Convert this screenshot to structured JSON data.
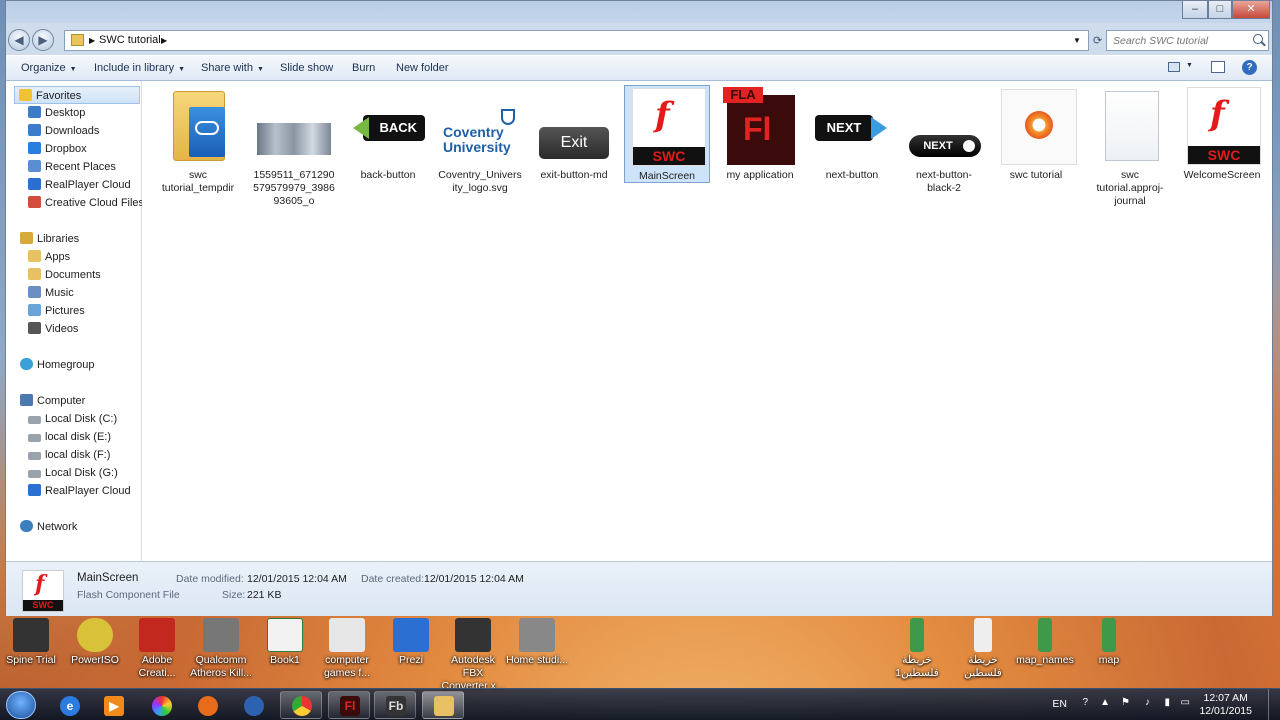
{
  "window": {
    "breadcrumb": [
      "SWC tutorial"
    ],
    "search_placeholder": "Search SWC tutorial",
    "controls": {
      "minimize": "–",
      "maximize": "□",
      "close": "✕"
    }
  },
  "toolbar": {
    "organize": "Organize",
    "include_in_library": "Include in library",
    "share_with": "Share with",
    "slide_show": "Slide show",
    "burn": "Burn",
    "new_folder": "New folder"
  },
  "navpane": {
    "favorites": "Favorites",
    "favorites_items": [
      "Desktop",
      "Downloads",
      "Dropbox",
      "Recent Places",
      "RealPlayer Cloud",
      "Creative Cloud Files"
    ],
    "libraries": "Libraries",
    "libraries_items": [
      "Apps",
      "Documents",
      "Music",
      "Pictures",
      "Videos"
    ],
    "homegroup": "Homegroup",
    "computer": "Computer",
    "computer_items": [
      "Local Disk (C:)",
      "local disk (E:)",
      "local disk (F:)",
      "Local Disk (G:)",
      "RealPlayer Cloud"
    ],
    "network": "Network"
  },
  "files": [
    {
      "name": "swc tutorial_tempdir",
      "icon": "cloud-folder-icon"
    },
    {
      "name": "1559511_671290579579979_398693605_o",
      "icon": "photo-thumbnail"
    },
    {
      "name": "back-button",
      "icon": "back-button-thumbnail",
      "thumb_text": "BACK"
    },
    {
      "name": "Coventry_University_logo.svg",
      "icon": "coventry-logo-thumbnail",
      "thumb_text": "Coventry University"
    },
    {
      "name": "exit-button-md",
      "icon": "exit-button-thumbnail",
      "thumb_text": "Exit"
    },
    {
      "name": "MainScreen",
      "icon": "swc-file-icon",
      "thumb_text": "SWC",
      "selected": true
    },
    {
      "name": "my application",
      "icon": "fla-file-icon",
      "thumb_text": "FLA"
    },
    {
      "name": "next-button",
      "icon": "next-button-thumbnail",
      "thumb_text": "NEXT"
    },
    {
      "name": "next-button-black-2",
      "icon": "next-button-black-thumbnail",
      "thumb_text": "NEXT"
    },
    {
      "name": "swc tutorial",
      "icon": "project-file-icon"
    },
    {
      "name": "swc tutorial.approj-journal",
      "icon": "blank-file-icon"
    },
    {
      "name": "WelcomeScreen",
      "icon": "swc-file-icon",
      "thumb_text": "SWC"
    }
  ],
  "details": {
    "name": "MainScreen",
    "type": "Flash Component File",
    "thumb_text": "SWC",
    "date_modified_label": "Date modified:",
    "date_modified": "12/01/2015 12:04 AM",
    "date_created_label": "Date created:",
    "date_created": "12/01/2015 12:04 AM",
    "size_label": "Size:",
    "size": "221 KB"
  },
  "desktop_icons": [
    "Spine Trial",
    "PowerISO",
    "Adobe Creati...",
    "Qualcomm Atheros Kill...",
    "Book1",
    "computer games f...",
    "Prezi",
    "Autodesk FBX Converter x...",
    "Home studi...",
    "خريطة فلسطين1",
    "خريطة فلسطين",
    "map_names",
    "map"
  ],
  "taskbar": {
    "apps": [
      "start",
      "ie",
      "media-player",
      "chrome-like",
      "firefox",
      "thunderbird",
      "chrome",
      "flash",
      "flash-builder",
      "explorer"
    ],
    "language": "EN",
    "time": "12:07 AM",
    "date": "12/01/2015"
  }
}
